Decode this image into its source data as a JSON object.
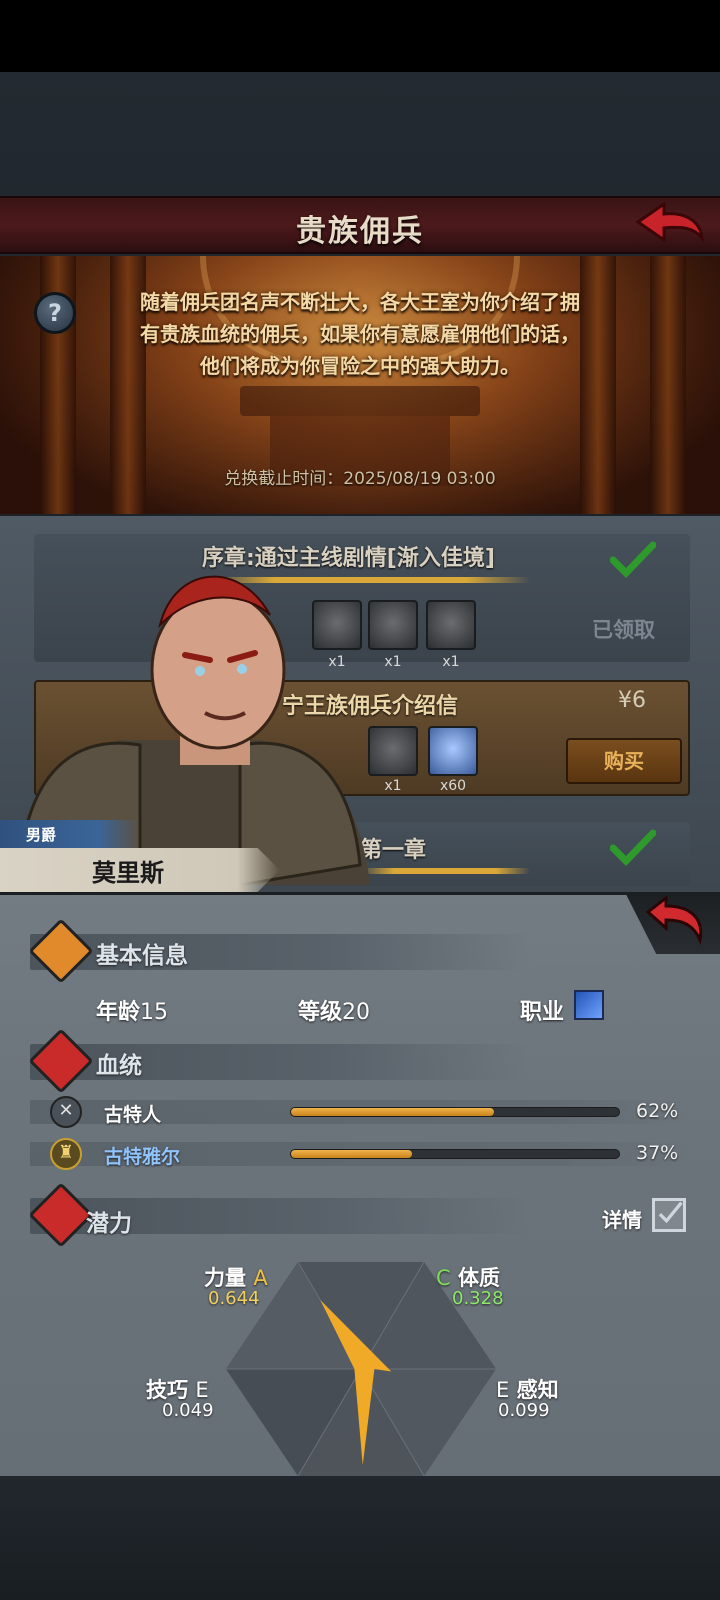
{
  "header": {
    "title": "贵族佣兵"
  },
  "banner": {
    "description_lines": [
      "随着佣兵团名声不断壮大，各大王室为你介绍了拥",
      "有贵族血统的佣兵，如果你有意愿雇佣他们的话，",
      "他们将成为你冒险之中的强大助力。"
    ],
    "deadline": "兑换截止时间：2025/08/19 03:00"
  },
  "quests": [
    {
      "title": "序章:通过主线剧情[渐入佳境]",
      "status": "已领取",
      "items": [
        {
          "icon": "helmet-icon",
          "count": "x1"
        },
        {
          "icon": "helmet-icon",
          "count": "x1"
        },
        {
          "icon": "helmet-icon",
          "count": "x1"
        }
      ]
    },
    {
      "title": "宁王族佣兵介绍信",
      "price": "¥6",
      "action": "购买",
      "items": [
        {
          "icon": "shield-icon",
          "count": "x1"
        },
        {
          "icon": "crystal-icon",
          "count": "x60"
        }
      ]
    },
    {
      "title": "第一章"
    }
  ],
  "character": {
    "rank": "男爵",
    "name": "莫里斯"
  },
  "basic_info": {
    "title": "基本信息",
    "age_label": "年龄",
    "age": "15",
    "level_label": "等级",
    "level": "20",
    "job_label": "职业"
  },
  "bloodline": {
    "title": "血统",
    "items": [
      {
        "name": "古特人",
        "percent": "62%",
        "fraction": 0.62,
        "color": "#ffffff"
      },
      {
        "name": "古特雅尔",
        "percent": "37%",
        "fraction": 0.37,
        "color": "#8fc4ff"
      }
    ]
  },
  "potential": {
    "title": "潜力",
    "detail_label": "详情",
    "stats": [
      {
        "name": "力量",
        "grade": "A",
        "value": "0.644",
        "grade_color": "#f0c040",
        "value_color": "#f0d060"
      },
      {
        "name": "体质",
        "grade": "C",
        "value": "0.328",
        "grade_color": "#7ddc5a",
        "value_color": "#8ee86a"
      },
      {
        "name": "技巧",
        "grade": "E",
        "value": "0.049",
        "grade_color": "#ffffff",
        "value_color": "#ffffff"
      },
      {
        "name": "感知",
        "grade": "E",
        "value": "0.099",
        "grade_color": "#ffffff",
        "value_color": "#ffffff"
      }
    ]
  },
  "colors": {
    "accent_gold": "#d9a838",
    "title_red": "#4d1a1c",
    "check_green": "#2f9a2c"
  }
}
